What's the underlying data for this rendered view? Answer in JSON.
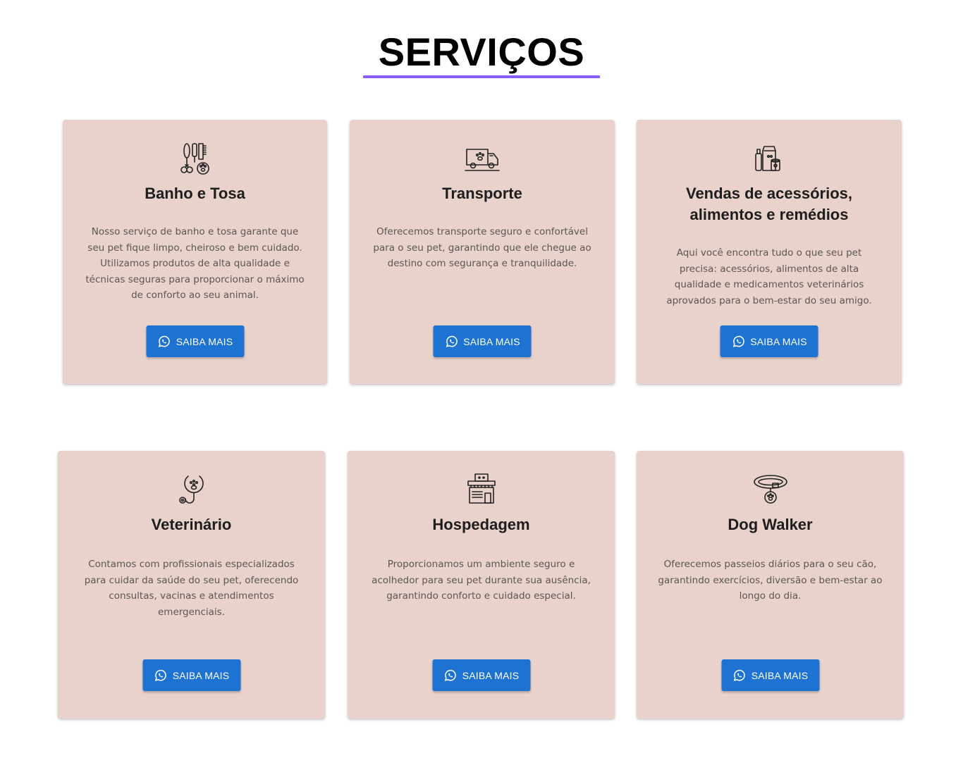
{
  "section": {
    "title": "SERVIÇOS",
    "accent_color": "#8b5cf6"
  },
  "theme": {
    "card_bg": "#e9d2cc",
    "button_bg": "#1e73d2"
  },
  "cards": [
    {
      "icon": "grooming-tools-icon",
      "title": "Banho e Tosa",
      "text": "Nosso serviço de banho e tosa garante que seu pet fique limpo, cheiroso e bem cuidado. Utilizamos produtos de alta qualidade e técnicas seguras para proporcionar o máximo de conforto ao seu animal.",
      "button": "SAIBA MAIS",
      "button_icon": "whatsapp-icon"
    },
    {
      "icon": "pet-transport-van-icon",
      "title": "Transporte",
      "text": "Oferecemos transporte seguro e confortável para o seu pet, garantindo que ele chegue ao destino com segurança e tranquilidade.",
      "button": "SAIBA MAIS",
      "button_icon": "whatsapp-icon"
    },
    {
      "icon": "pet-products-icon",
      "title": "Vendas de acessórios, alimentos e remédios",
      "text": "Aqui você encontra tudo o que seu pet precisa: acessórios, alimentos de alta qualidade e medicamentos veterinários aprovados para o bem-estar do seu amigo.",
      "button": "SAIBA MAIS",
      "button_icon": "whatsapp-icon"
    },
    {
      "icon": "stethoscope-paw-icon",
      "title": "Veterinário",
      "text": "Contamos com profissionais especializados para cuidar da saúde do seu pet, oferecendo consultas, vacinas e atendimentos emergenciais.",
      "button": "SAIBA MAIS",
      "button_icon": "whatsapp-icon"
    },
    {
      "icon": "pet-hotel-icon",
      "title": "Hospedagem",
      "text": "Proporcionamos um ambiente seguro e acolhedor para seu pet durante sua ausência, garantindo conforto e cuidado especial.",
      "button": "SAIBA MAIS",
      "button_icon": "whatsapp-icon"
    },
    {
      "icon": "dog-collar-icon",
      "title": "Dog Walker",
      "text": "Oferecemos passeios diários para o seu cão, garantindo exercícios, diversão e bem-estar ao longo do dia.",
      "button": "SAIBA MAIS",
      "button_icon": "whatsapp-icon"
    }
  ]
}
